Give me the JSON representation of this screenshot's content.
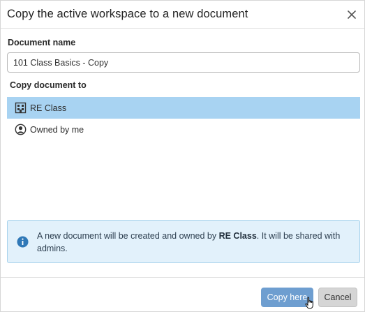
{
  "dialog": {
    "title": "Copy the active workspace to a new document"
  },
  "document_name": {
    "label": "Document name",
    "value": "101 Class Basics - Copy"
  },
  "copy_to": {
    "label": "Copy document to",
    "items": [
      {
        "label": "RE Class",
        "icon": "company-icon",
        "selected": true
      },
      {
        "label": "Owned by me",
        "icon": "user-circle-icon",
        "selected": false
      }
    ]
  },
  "info": {
    "icon": "info-icon",
    "prefix": "A new document will be created and owned by ",
    "owner": "RE Class",
    "suffix": ". It will be shared with admins."
  },
  "footer": {
    "copy_label": "Copy here",
    "cancel_label": "Cancel"
  },
  "colors": {
    "selected_row": "#a8d3f2",
    "primary_button": "#6e9ed0",
    "info_background": "#e2f1fb"
  }
}
